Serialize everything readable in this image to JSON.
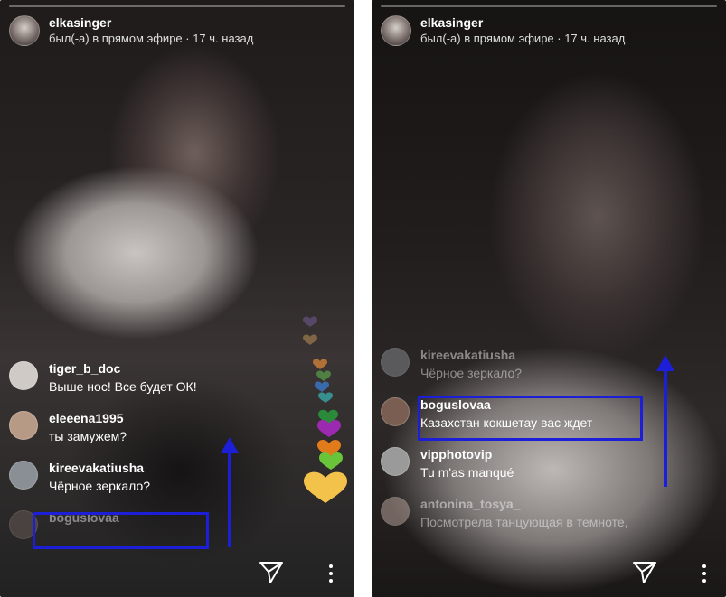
{
  "colors": {
    "highlight": "#1c1ed8",
    "text": "#ffffff"
  },
  "left_panel": {
    "header": {
      "username": "elkasinger",
      "status": "был(-а) в прямом эфире · 17 ч. назад"
    },
    "comments": [
      {
        "user": "tiger_b_doc",
        "text": "Выше нос! Все будет ОК!",
        "avatar_color": "#cfcac6"
      },
      {
        "user": "eleeena1995",
        "text": "ты замужем?",
        "avatar_color": "#b79a85"
      },
      {
        "user": "kireevakatiusha",
        "text": "Чёрное зеркало?",
        "avatar_color": "#8a8f95"
      },
      {
        "user": "boguslovaa",
        "text": "",
        "avatar_color": "#6a5d58"
      }
    ],
    "hearts": [
      "#7a5fa0",
      "#c79a5a",
      "#e28a3a",
      "#5aa04a",
      "#3a78c9",
      "#3aa8a8",
      "#2a8a3a",
      "#9b2ab0",
      "#e07a1a",
      "#6ac43a",
      "#f3c24a"
    ],
    "icons": [
      "send-icon",
      "more-options-icon",
      "up-arrow-icon"
    ]
  },
  "right_panel": {
    "header": {
      "username": "elkasinger",
      "status": "был(-а) в прямом эфире · 17 ч. назад"
    },
    "comments": [
      {
        "user": "kireevakatiusha",
        "text": "Чёрное зеркало?",
        "avatar_color": "#8a8f95"
      },
      {
        "user": "boguslovaa",
        "text": "Казахстан кокшетау  вас  ждет",
        "avatar_color": "#7a5e52"
      },
      {
        "user": "vipphotovip",
        "text": "Tu m'as manqué",
        "avatar_color": "#9a9a9a"
      },
      {
        "user": "antonina_tosya_",
        "text": "Посмотрела танцующая в темноте,",
        "avatar_color": "#c0a9a0"
      }
    ],
    "icons": [
      "send-icon",
      "more-options-icon",
      "up-arrow-icon"
    ]
  }
}
